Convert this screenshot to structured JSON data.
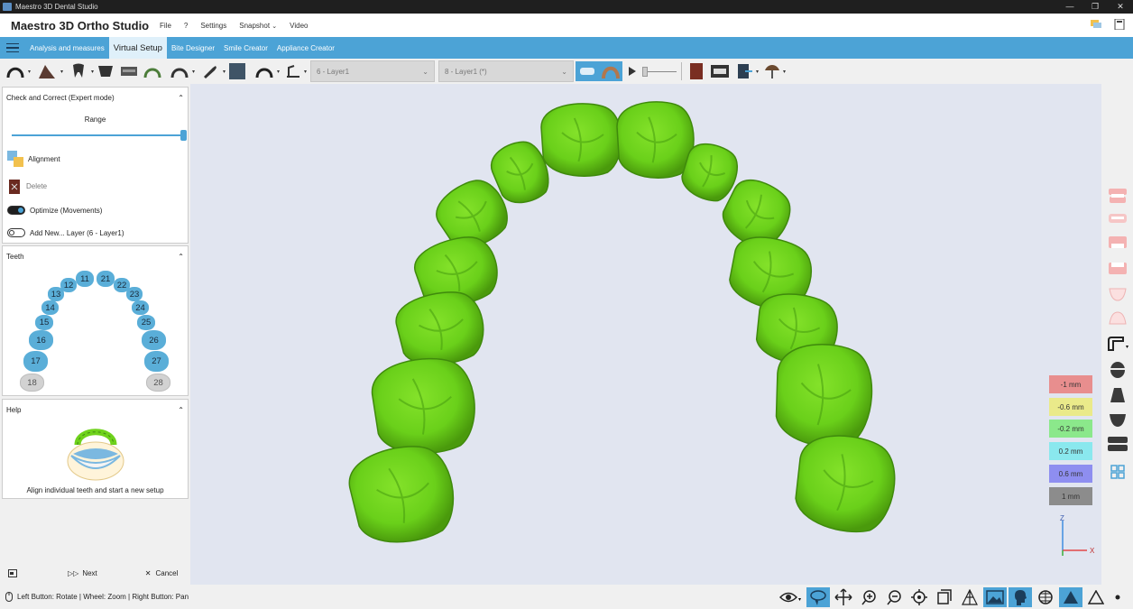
{
  "window": {
    "title": "Maestro 3D Dental Studio"
  },
  "menubar": {
    "app_title": "Maestro 3D Ortho Studio",
    "items": [
      "File",
      "?",
      "Settings",
      "Snapshot",
      "Video"
    ]
  },
  "tabs": [
    "Analysis and measures",
    "Virtual Setup",
    "Bite Designer",
    "Smile Creator",
    "Appliance Creator"
  ],
  "active_tab": "Virtual Setup",
  "toolbar": {
    "layer_combo_1": "6 - Layer1",
    "layer_combo_2": "8 - Layer1 (*)"
  },
  "check_panel": {
    "title": "Check and Correct (Expert mode)",
    "range_label": "Range",
    "range_value": 1.0,
    "alignment_label": "Alignment",
    "delete_label": "Delete",
    "optimize_label": "Optimize (Movements)",
    "optimize_on": true,
    "add_new_label": "Add New... Layer (6 - Layer1)",
    "add_new_on": false
  },
  "teeth_panel": {
    "title": "Teeth",
    "teeth": [
      "11",
      "12",
      "13",
      "14",
      "15",
      "16",
      "17",
      "18",
      "21",
      "22",
      "23",
      "24",
      "25",
      "26",
      "27",
      "28"
    ]
  },
  "help_panel": {
    "title": "Help",
    "text": "Align individual teeth and start a new setup"
  },
  "bottom_buttons": {
    "next": "Next",
    "cancel": "Cancel"
  },
  "legend": {
    "items": [
      {
        "label": "-1 mm",
        "color": "#e88e8e"
      },
      {
        "label": "-0.6 mm",
        "color": "#eaea8a"
      },
      {
        "label": "-0.2 mm",
        "color": "#8be88b"
      },
      {
        "label": "0.2 mm",
        "color": "#8ae8ee"
      },
      {
        "label": "0.6 mm",
        "color": "#8e8ef0"
      },
      {
        "label": "1 mm",
        "color": "#8c8c8c"
      }
    ]
  },
  "axes": {
    "z": "Z",
    "x": "X"
  },
  "statusbar": {
    "text": "Left Button: Rotate | Wheel: Zoom | Right Button: Pan"
  },
  "colors": {
    "accent": "#4ca3d6",
    "tooth_surface": "#6fd21c",
    "viewport_bg": "#e1e5f0"
  }
}
